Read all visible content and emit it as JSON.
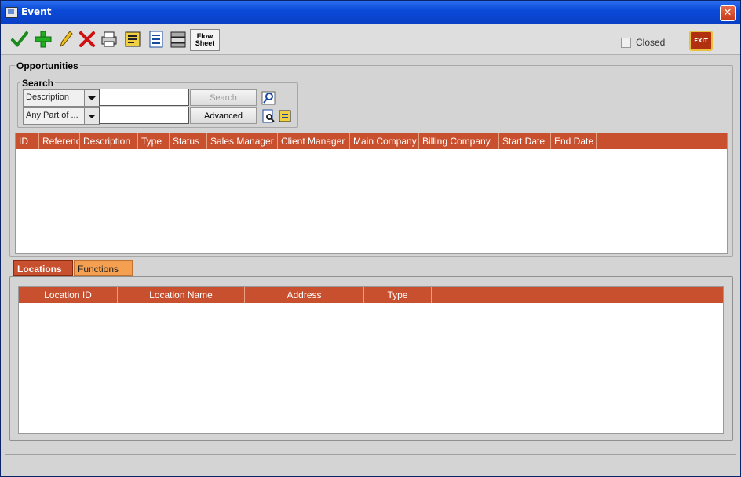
{
  "window": {
    "title": "Event"
  },
  "toolbar": {
    "flow_sheet_label_line1": "Flow",
    "flow_sheet_label_line2": "Sheet",
    "closed_label": "Closed",
    "exit_label": "EXIT"
  },
  "opportunities": {
    "title": "Opportunities",
    "search": {
      "title": "Search",
      "field_select": "Description",
      "match_select": "Any Part of ...",
      "search_button": "Search",
      "advanced_button": "Advanced"
    },
    "columns": [
      "ID",
      "Reference#",
      "Description",
      "Type",
      "Status",
      "Sales Manager",
      "Client Manager",
      "Main Company",
      "Billing Company",
      "Start Date",
      "End Date"
    ],
    "rows": []
  },
  "tabs": [
    {
      "label": "Locations",
      "active": true
    },
    {
      "label": "Functions",
      "active": false
    }
  ],
  "locations": {
    "columns": [
      "Location ID",
      "Location Name",
      "Address",
      "Type"
    ],
    "rows": []
  },
  "colors": {
    "header_bg": "#c9502f",
    "tab_active": "#c9502f",
    "tab_inactive": "#f5a050",
    "titlebar": "#0a4ad8"
  }
}
